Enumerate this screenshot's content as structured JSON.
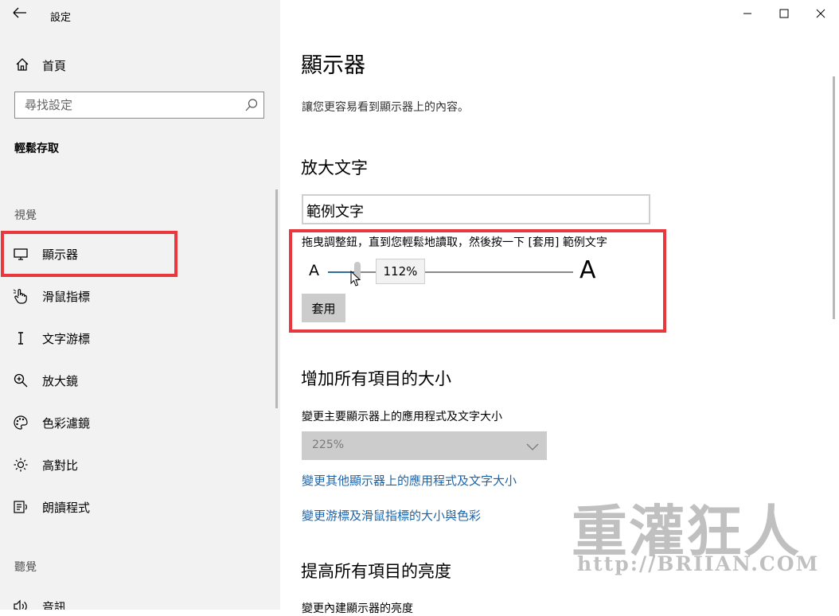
{
  "window": {
    "title": "設定",
    "controls": [
      "minimize-icon",
      "maximize-icon",
      "close-icon"
    ]
  },
  "sidebar": {
    "home_label": "首頁",
    "search_placeholder": "尋找設定",
    "section_title": "輕鬆存取",
    "group_vision": "視覺",
    "group_hearing": "聽覺",
    "items": [
      {
        "label": "顯示器",
        "icon": "monitor-icon",
        "selected": true
      },
      {
        "label": "滑鼠指標",
        "icon": "hand-pointer-icon"
      },
      {
        "label": "文字游標",
        "icon": "text-cursor-icon"
      },
      {
        "label": "放大鏡",
        "icon": "magnifier-icon"
      },
      {
        "label": "色彩濾鏡",
        "icon": "palette-icon"
      },
      {
        "label": "高對比",
        "icon": "brightness-icon"
      },
      {
        "label": "朗讀程式",
        "icon": "narrator-icon"
      }
    ],
    "hearing_items": [
      {
        "label": "音訊",
        "icon": "speaker-icon"
      }
    ]
  },
  "main": {
    "title": "顯示器",
    "description": "讓您更容易看到顯示器上的內容。",
    "text_size": {
      "heading": "放大文字",
      "sample_text": "範例文字",
      "instruction": "拖曳調整鈕，直到您輕鬆地讀取，然後按一下 [套用] 範例文字",
      "small_a": "A",
      "large_a": "A",
      "slider_value": "112%",
      "slider_fraction": 0.12,
      "apply_label": "套用"
    },
    "scale": {
      "heading": "增加所有項目的大小",
      "label": "變更主要顯示器上的應用程式及文字大小",
      "dropdown_value": "225%",
      "link_other": "變更其他顯示器上的應用程式及文字大小",
      "link_cursor": "變更游標及滑鼠指標的大小與色彩"
    },
    "brightness": {
      "heading": "提高所有項目的亮度",
      "label": "變更內建顯示器的亮度"
    }
  },
  "watermark": {
    "line1": "重灌狂人",
    "line2": "http://BRIIAN.COM"
  },
  "colors": {
    "highlight": "#e8383d",
    "link": "#1a65ad",
    "slider_fill": "#2a6ea0",
    "sidebar_bg": "#f2f2f2"
  }
}
